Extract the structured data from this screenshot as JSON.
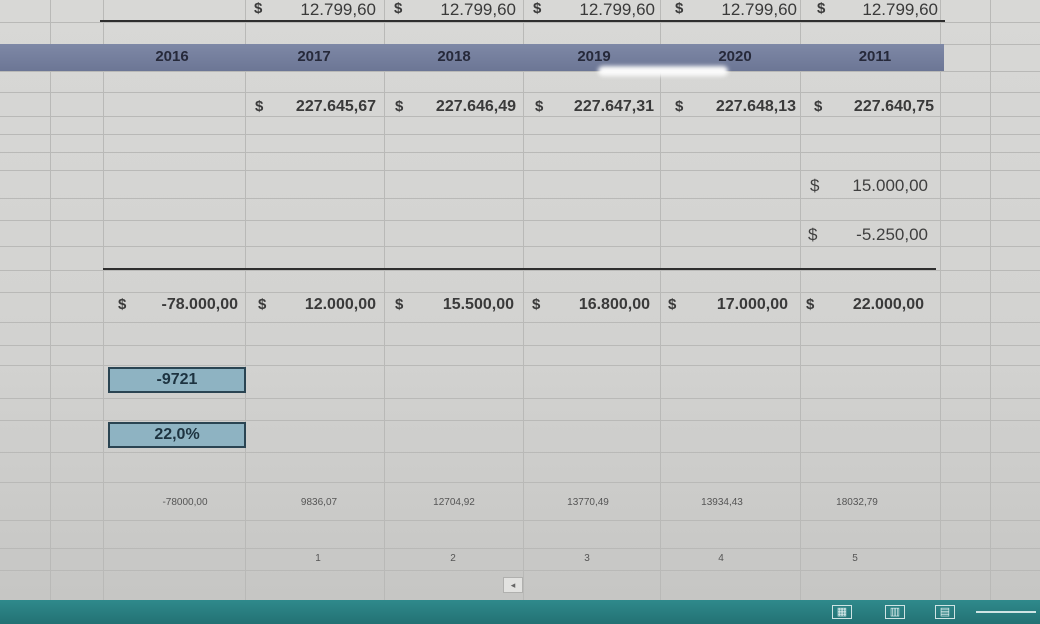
{
  "top_row": {
    "currency": [
      "$",
      "$",
      "$",
      "$",
      "$"
    ],
    "values": [
      "12.799,60",
      "12.799,60",
      "12.799,60",
      "12.799,60",
      "12.799,60"
    ]
  },
  "years": [
    "2016",
    "2017",
    "2018",
    "2019",
    "2020",
    "2011"
  ],
  "totals_row": {
    "currency": [
      "$",
      "$",
      "$",
      "$",
      "$"
    ],
    "values": [
      "227.645,67",
      "227.646,49",
      "227.647,31",
      "227.648,13",
      "227.640,75"
    ]
  },
  "side_values": {
    "currency": [
      "$",
      "$"
    ],
    "values": [
      "15.000,00",
      "-5.250,00"
    ]
  },
  "cashflow_row": {
    "currency": [
      "$",
      "$",
      "$",
      "$",
      "$",
      "$"
    ],
    "values": [
      "-78.000,00",
      "12.000,00",
      "15.500,00",
      "16.800,00",
      "17.000,00",
      "22.000,00"
    ]
  },
  "result_boxes": {
    "npv": "-9721",
    "irr": "22,0%"
  },
  "discounted_row": [
    "-78000,00",
    "9836,07",
    "12704,92",
    "13770,49",
    "13934,43",
    "18032,79"
  ],
  "period_row": [
    "1",
    "2",
    "3",
    "4",
    "5"
  ],
  "scroll_left_glyph": "◂",
  "status_bar": {
    "view_icons": [
      "grid-view-icon",
      "page-layout-icon",
      "page-break-icon"
    ],
    "accent_color": "#2a8082"
  }
}
